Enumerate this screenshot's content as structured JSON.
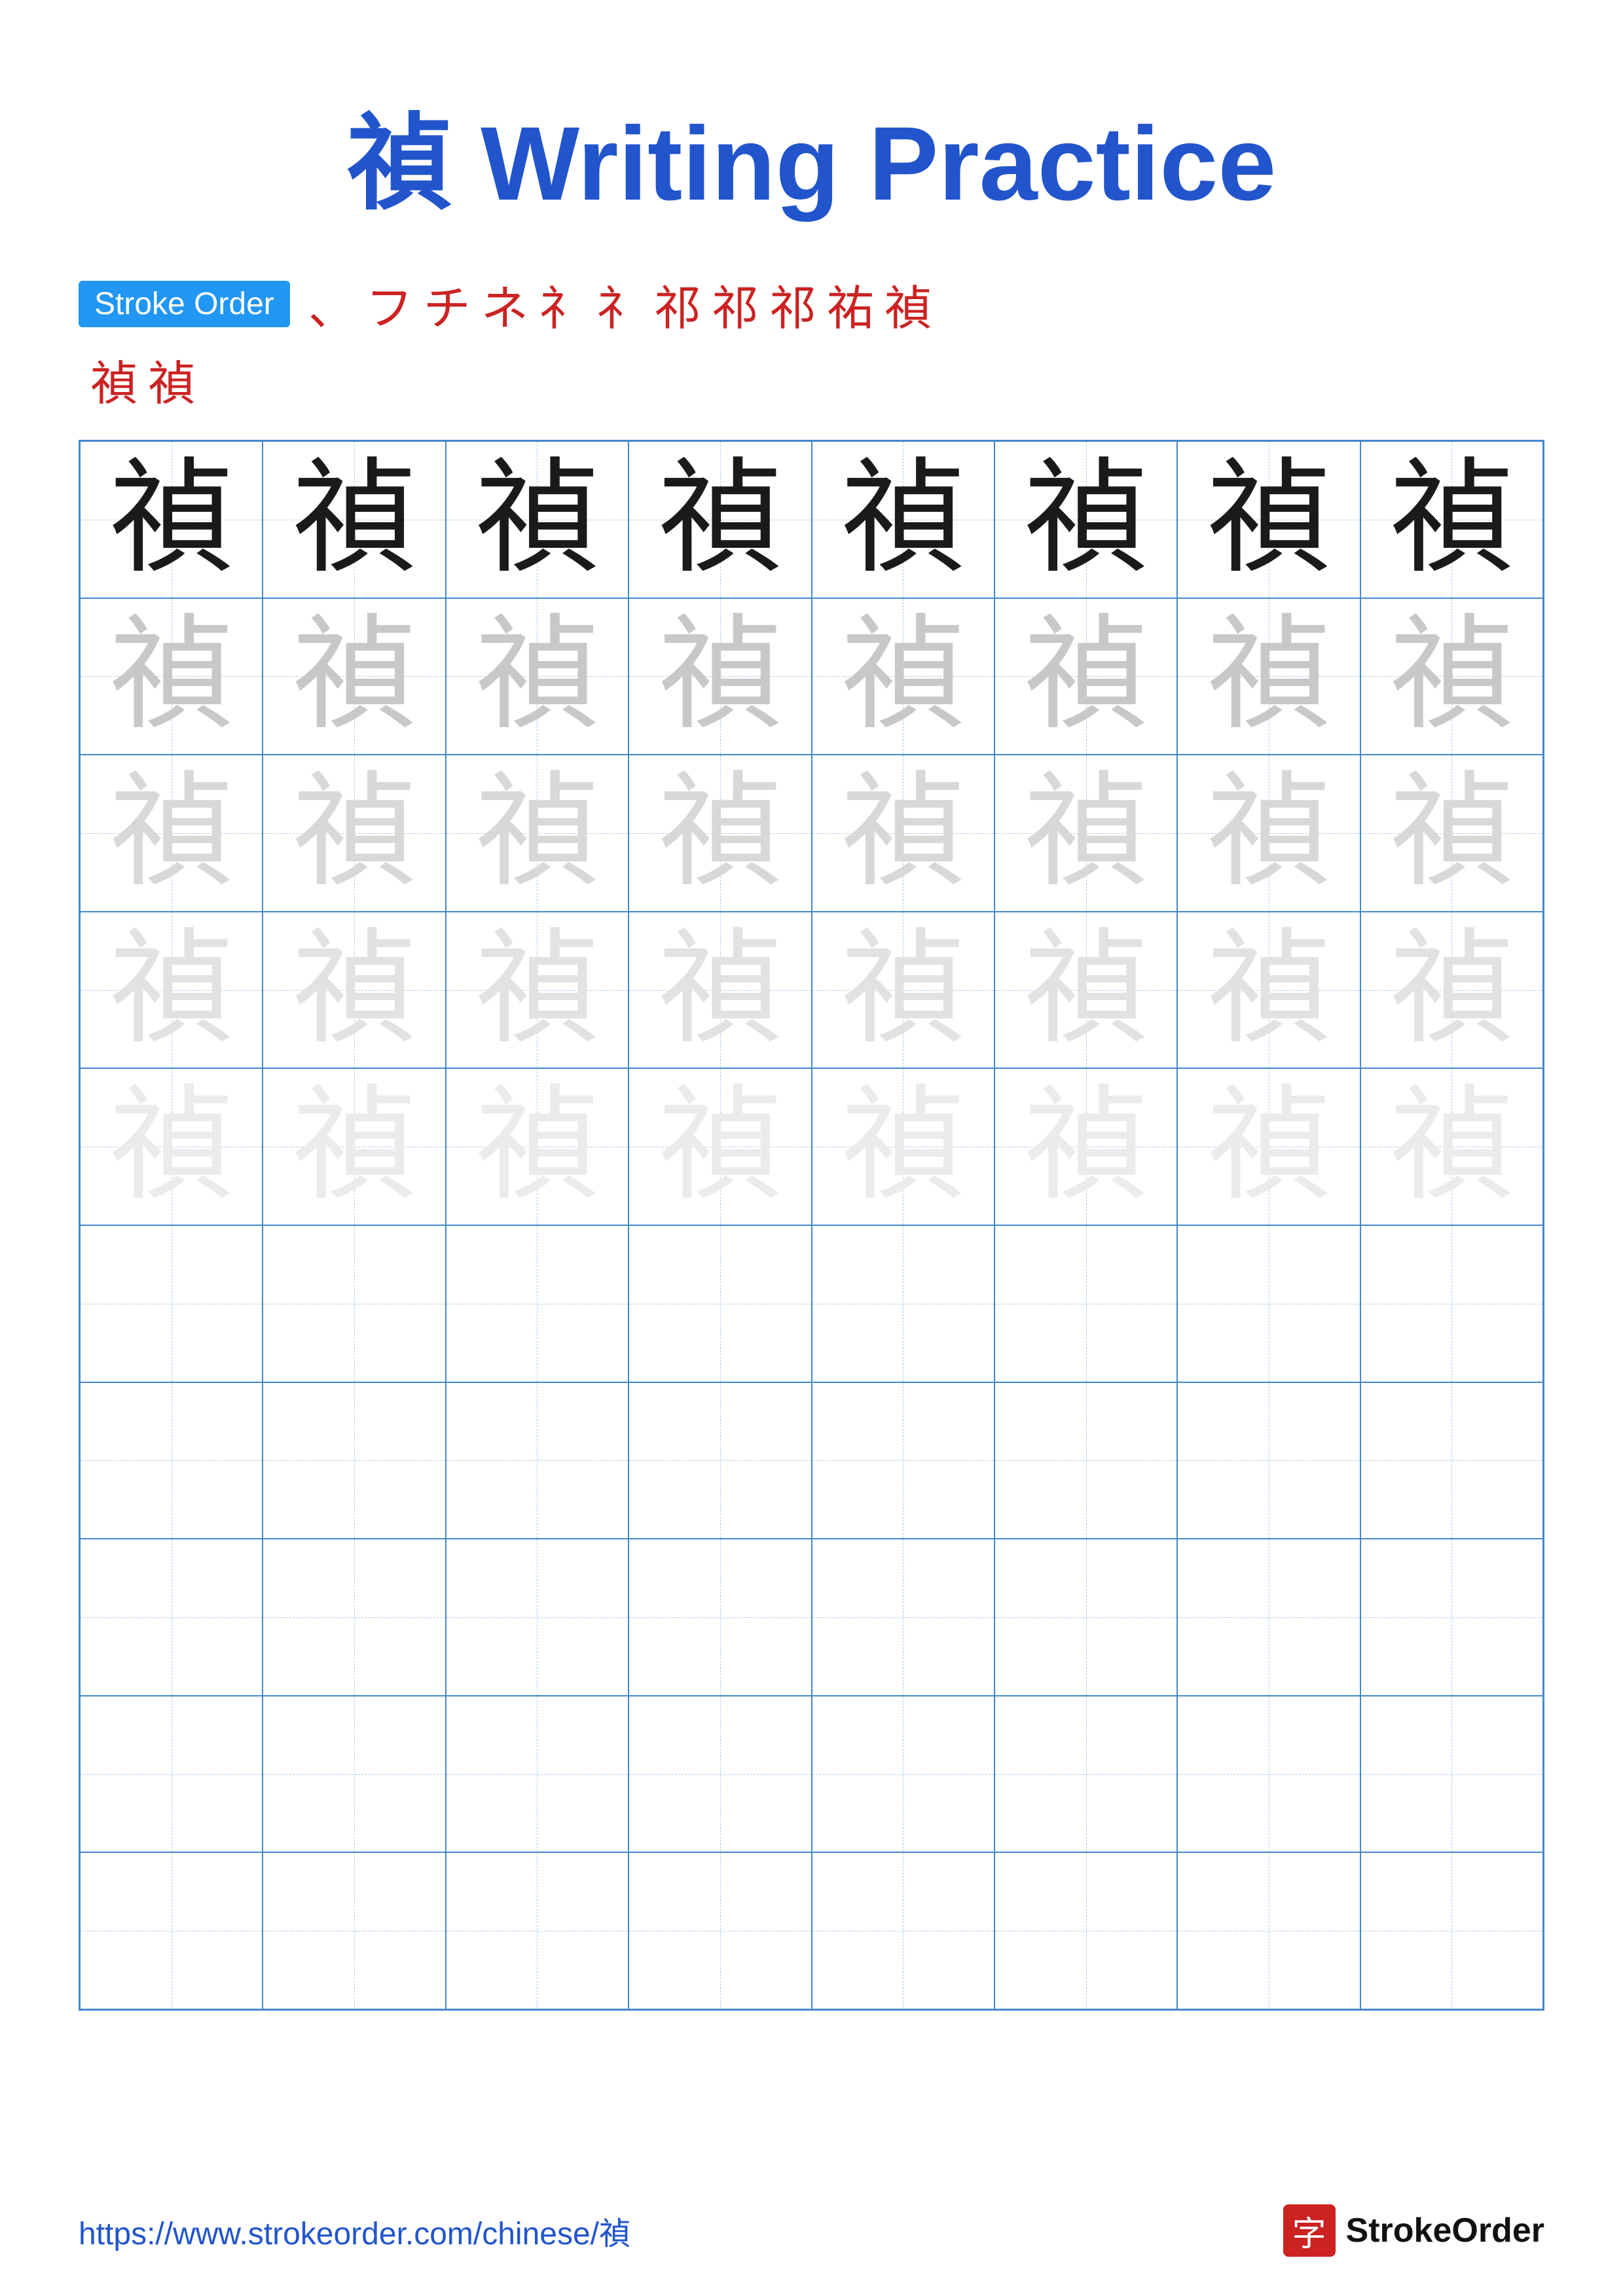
{
  "title": {
    "char": "禎",
    "text": " Writing Practice"
  },
  "stroke_order": {
    "badge_label": "Stroke Order",
    "strokes_row1": [
      "、",
      "フ",
      "チ",
      "ネ",
      "礻",
      "礻",
      "祁",
      "祁",
      "祁",
      "祐",
      "禎"
    ],
    "strokes_row2": [
      "禎",
      "禎"
    ]
  },
  "practice_char": "禎",
  "grid": {
    "cols": 8,
    "rows": 10,
    "row_shades": [
      "dark",
      "light1",
      "light2",
      "light3",
      "light4",
      "empty",
      "empty",
      "empty",
      "empty",
      "empty"
    ]
  },
  "footer": {
    "url": "https://www.strokeorder.com/chinese/禎",
    "brand_char": "字",
    "brand_name": "StrokeOrder"
  }
}
